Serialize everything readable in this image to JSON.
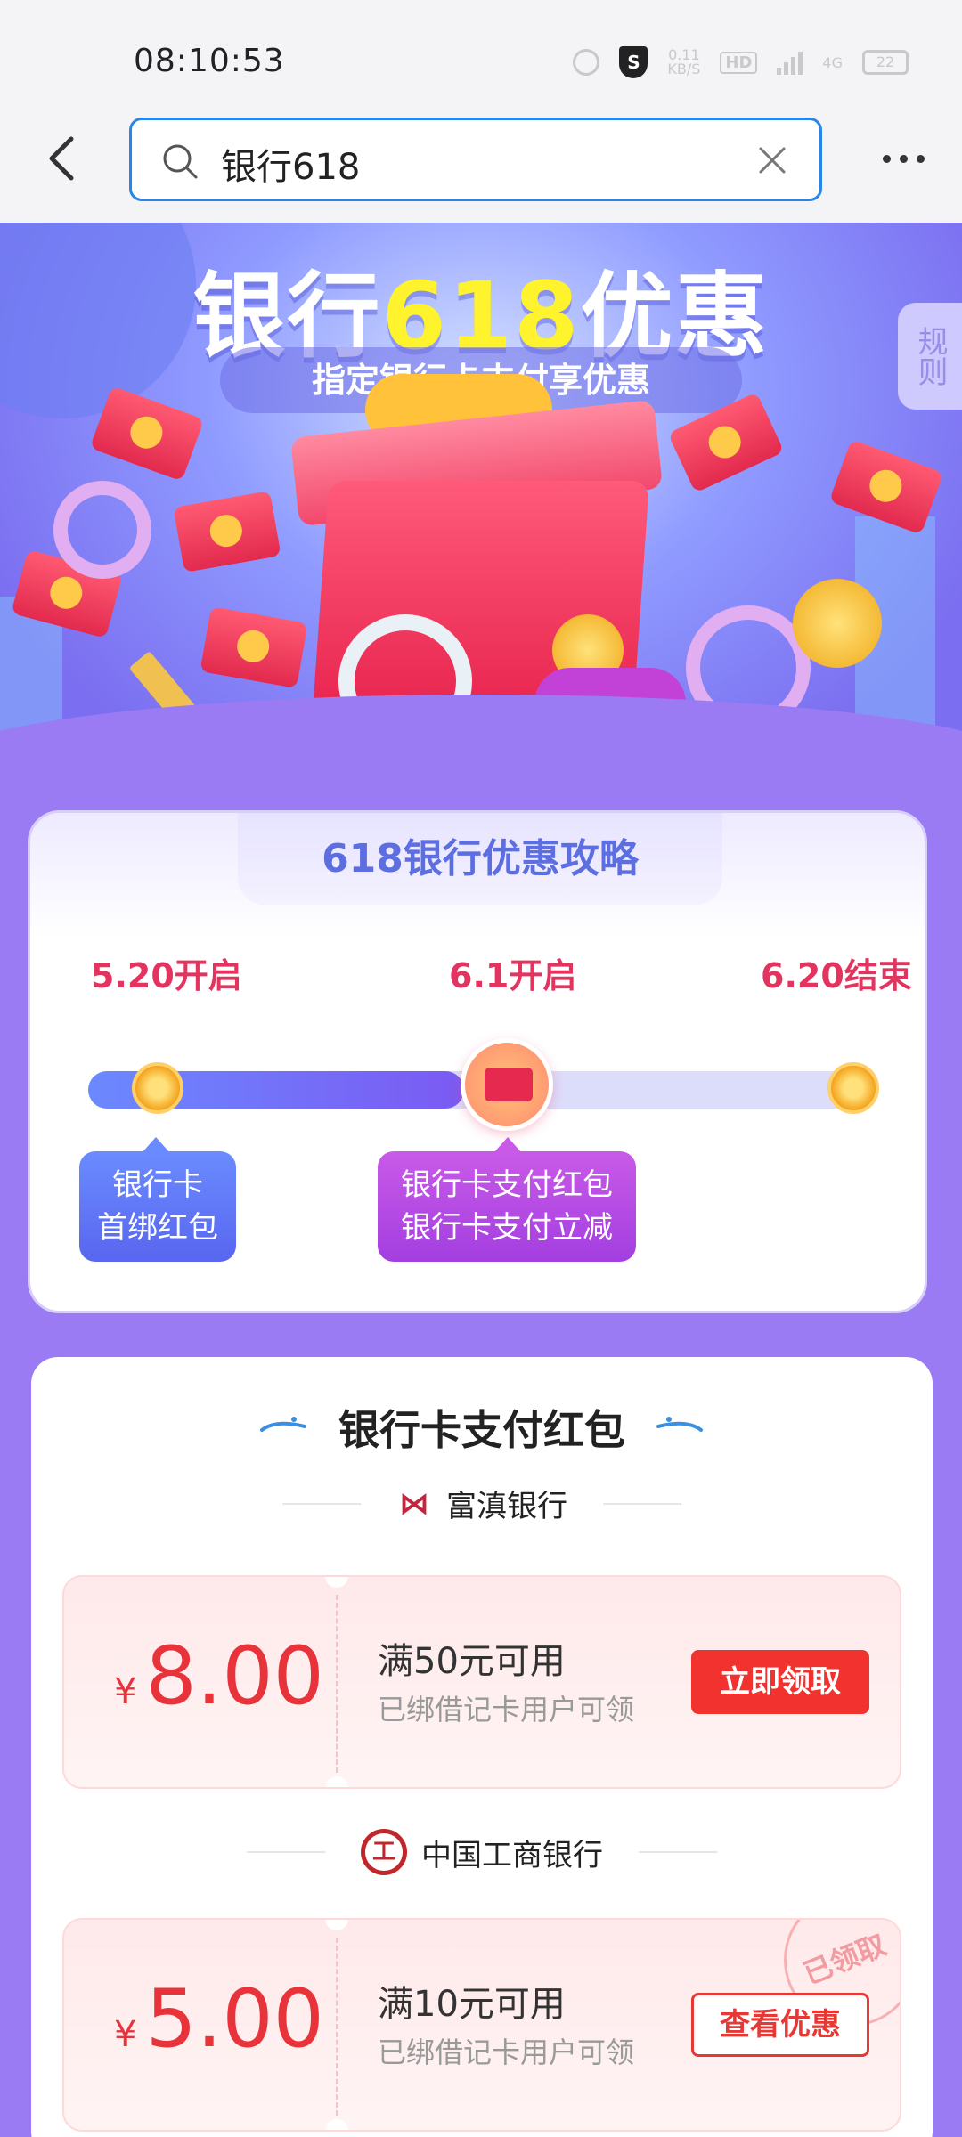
{
  "status": {
    "time": "08:10:53",
    "speed_value": "0.11",
    "speed_unit": "KB/S",
    "hd": "HD",
    "net": "4G",
    "battery": "22"
  },
  "nav": {
    "search_value": "银行618"
  },
  "banner": {
    "title_prefix": "银行",
    "title_highlight": "618",
    "title_suffix": "优惠",
    "subtitle": "指定银行卡支付享优惠",
    "rules_label": "规则"
  },
  "strategy": {
    "title": "618银行优惠攻略",
    "progress": 0.48,
    "milestones": [
      {
        "date": "5.20开启"
      },
      {
        "date": "6.1开启"
      },
      {
        "date": "6.20结束"
      }
    ],
    "tag_left_line1": "银行卡",
    "tag_left_line2": "首绑红包",
    "tag_mid_line1": "银行卡支付红包",
    "tag_mid_line2": "银行卡支付立减"
  },
  "red_packets": {
    "section_title": "银行卡支付红包",
    "banks": [
      {
        "name": "富滇银行",
        "logo_text": "⋈",
        "coupon": {
          "currency": "¥",
          "amount": "8.00",
          "condition": "满50元可用",
          "note": "已绑借记卡用户可领",
          "button": "立即领取"
        }
      },
      {
        "name": "中国工商银行",
        "logo_text": "工",
        "coupon": {
          "currency": "¥",
          "amount": "5.00",
          "condition": "满10元可用",
          "note": "已绑借记卡用户可领",
          "button": "查看优惠",
          "stamp": "已领取"
        }
      }
    ]
  }
}
